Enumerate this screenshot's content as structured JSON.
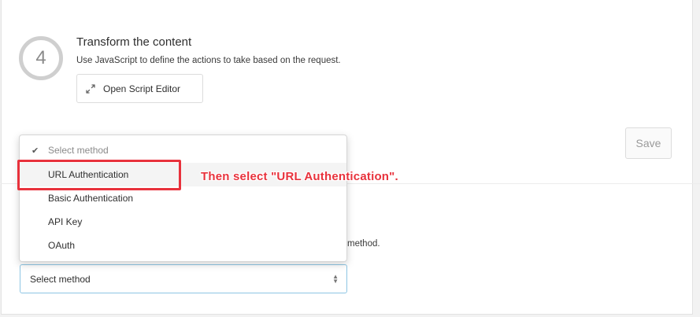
{
  "step": {
    "number": "4",
    "title": "Transform the content",
    "description": "Use JavaScript to define the actions to take based on the request.",
    "script_button_label": "Open Script Editor",
    "script_button_icon": "expand-icon"
  },
  "save_button_label": "Save",
  "method_section": {
    "description_tail": "method."
  },
  "dropdown": {
    "options": [
      {
        "label": "Select method",
        "checked": true
      },
      {
        "label": "URL Authentication",
        "highlighted": true
      },
      {
        "label": "Basic Authentication"
      },
      {
        "label": "API Key"
      },
      {
        "label": "OAuth"
      }
    ]
  },
  "select": {
    "value": "Select method"
  },
  "annotation": {
    "text": "Then select \"URL Authentication\".",
    "color": "#e8323c"
  },
  "colors": {
    "select_focus_border": "#8ec6e4",
    "save_text": "#9a9a9a"
  }
}
